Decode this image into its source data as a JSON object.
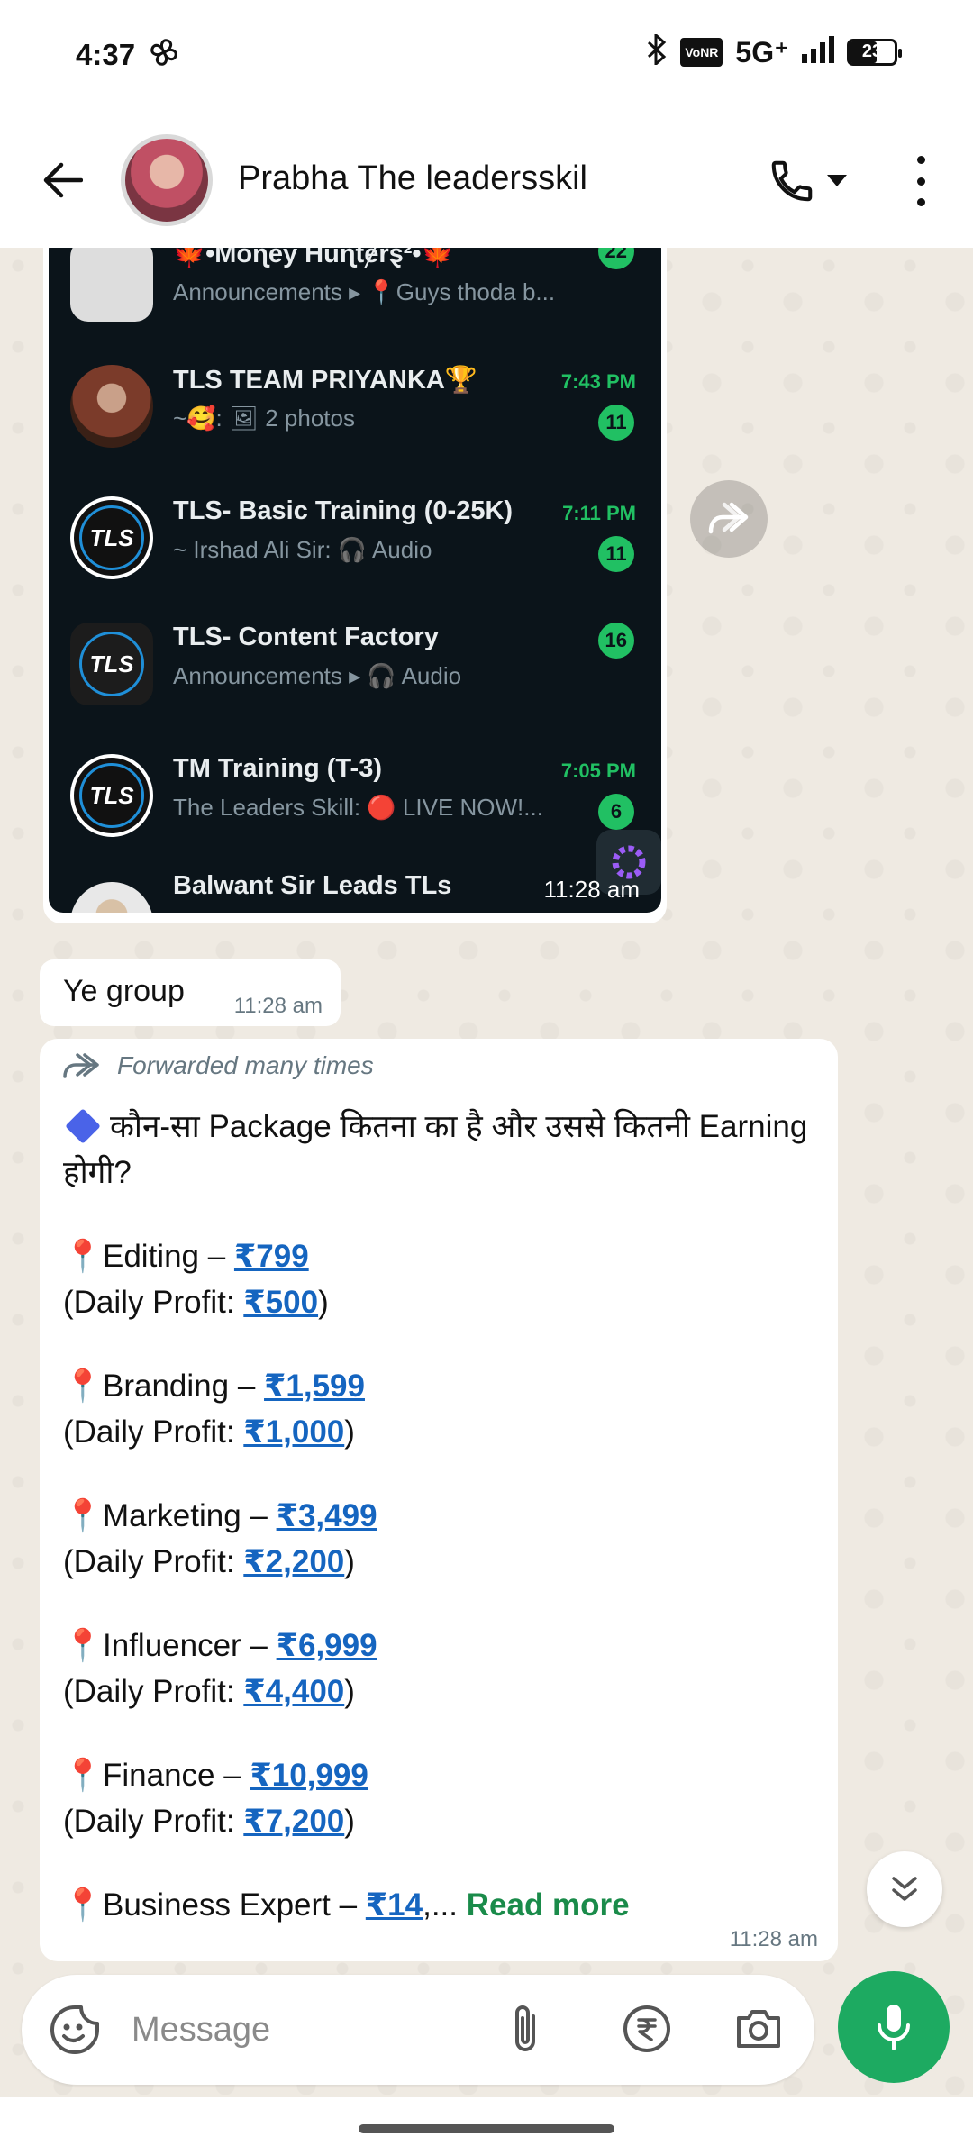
{
  "status_bar": {
    "time": "4:37",
    "network": "5G⁺",
    "volte": "VoNR",
    "battery": "23"
  },
  "header": {
    "contact_name": "Prabha The leadersskil"
  },
  "image_message": {
    "time": "11:28 am",
    "rows": [
      {
        "title": "🍁•Moɳeÿ Hüɳtɇrȿ²•🍁",
        "subtitle": "Announcements ▸ 📍Guys thoda b...",
        "time": "",
        "badge": "22",
        "icon": "money-hunters-icon"
      },
      {
        "title": "TLS TEAM PRIYANKA🏆",
        "subtitle": "~🥰: 🖼 2 photos",
        "time": "7:43 PM",
        "badge": "11",
        "icon": "group-photo-icon"
      },
      {
        "title": "TLS- Basic Training (0-25K)",
        "subtitle": "~ Irshad Ali Sir: 🎧 Audio",
        "time": "7:11 PM",
        "badge": "11",
        "icon": "tls-logo-icon"
      },
      {
        "title": "TLS- Content Factory",
        "subtitle": "Announcements ▸ 🎧 Audio",
        "time": "",
        "badge": "16",
        "icon": "tls-community-icon"
      },
      {
        "title": "TM Training (T-3)",
        "subtitle": "The Leaders Skill: 🔴 LIVE NOW!...",
        "time": "7:05 PM",
        "badge": "6",
        "icon": "tls-logo-icon"
      },
      {
        "title": "Balwant Sir Leads TLs",
        "subtitle": "",
        "time": "",
        "badge": "",
        "icon": "person-photo-icon"
      }
    ]
  },
  "msg_short": {
    "text": "Ye group",
    "time": "11:28 am"
  },
  "msg_long": {
    "forwarded_label": "Forwarded many times",
    "heading": "कौन-सा Package कितना का है और उससे कितनी Earning होगी?",
    "items": [
      {
        "name": "Editing – ",
        "price": "₹799",
        "profit_label": "(Daily Profit: ",
        "profit": "₹500",
        "close": ")"
      },
      {
        "name": "Branding – ",
        "price": "₹1,599",
        "profit_label": "(Daily Profit: ",
        "profit": "₹1,000",
        "close": ")"
      },
      {
        "name": "Marketing – ",
        "price": "₹3,499",
        "profit_label": "(Daily Profit: ",
        "profit": "₹2,200",
        "close": ")"
      },
      {
        "name": "Influencer – ",
        "price": "₹6,999",
        "profit_label": "(Daily Profit: ",
        "profit": "₹4,400",
        "close": ")"
      },
      {
        "name": "Finance – ",
        "price": "₹10,999",
        "profit_label": "(Daily Profit: ",
        "profit": "₹7,200",
        "close": ")"
      }
    ],
    "last_item": {
      "name": "Business Expert – ",
      "price": "₹14",
      "ellipsis": ",... ",
      "read_more": "Read more"
    },
    "time": "11:28 am"
  },
  "input": {
    "placeholder": "Message"
  },
  "colors": {
    "accent": "#1daa61",
    "link": "#1565c0",
    "wa_dark": "#0b141a"
  }
}
